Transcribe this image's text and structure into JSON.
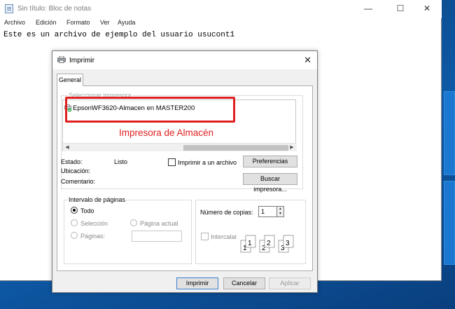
{
  "notepad": {
    "title": "Sin título: Bloc de notas",
    "minimize": "—",
    "maximize": "☐",
    "close": "✕",
    "menu": [
      "Archivo",
      "Edición",
      "Formato",
      "Ver",
      "Ayuda"
    ],
    "content": "Este es un archivo de ejemplo del usuario usucont1"
  },
  "dialog": {
    "title": "Imprimir",
    "close": "✕",
    "tab": "General",
    "select_printer": {
      "label": "Seleccionar impresora",
      "printer_name": "EpsonWF3620-Almacen en MASTER200",
      "annotation": "Impresora de Almacén"
    },
    "status_label": "Estado:",
    "status_value": "Listo",
    "location_label": "Ubicación:",
    "comment_label": "Comentario:",
    "print_to_file": "Imprimir a un archivo",
    "preferences_button": "Preferencias",
    "find_printer_button": "Buscar impresora...",
    "page_range": {
      "label": "Intervalo de páginas",
      "all": "Todo",
      "selection": "Selección",
      "current_page": "Página actual",
      "pages": "Páginas:",
      "selected": "Todo"
    },
    "copies": {
      "label": "Número de copias:",
      "value": "1",
      "collate": "Intercalar"
    },
    "buttons": {
      "print": "Imprimir",
      "cancel": "Cancelar",
      "apply": "Aplicar"
    }
  },
  "colors": {
    "highlight": "#e02020",
    "desktop": "#0e5aa7"
  }
}
